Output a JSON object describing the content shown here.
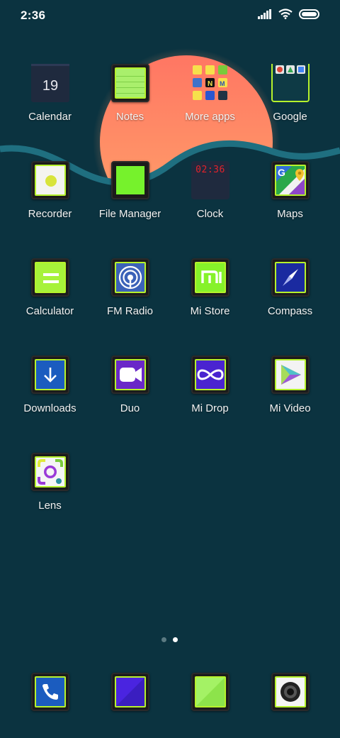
{
  "status": {
    "time": "2:36"
  },
  "colors": {
    "background": "#0b3340",
    "sun_top": "#ff7a63",
    "sun_bottom": "#ffa06a",
    "wave": "#1f6f80",
    "accent": "#b6f22c"
  },
  "apps": [
    {
      "label": "Calendar",
      "icon": "calendar-icon",
      "date": "19"
    },
    {
      "label": "Notes",
      "icon": "notes-icon"
    },
    {
      "label": "More apps",
      "icon": "folder-icon"
    },
    {
      "label": "Google",
      "icon": "google-folder-icon"
    },
    {
      "label": "Recorder",
      "icon": "recorder-icon"
    },
    {
      "label": "File Manager",
      "icon": "file-manager-icon"
    },
    {
      "label": "Clock",
      "icon": "clock-icon",
      "display": "02:36"
    },
    {
      "label": "Maps",
      "icon": "maps-icon"
    },
    {
      "label": "Calculator",
      "icon": "calculator-icon"
    },
    {
      "label": "FM Radio",
      "icon": "radio-icon"
    },
    {
      "label": "Mi Store",
      "icon": "mi-store-icon"
    },
    {
      "label": "Compass",
      "icon": "compass-icon"
    },
    {
      "label": "Downloads",
      "icon": "download-icon"
    },
    {
      "label": "Duo",
      "icon": "video-call-icon"
    },
    {
      "label": "Mi Drop",
      "icon": "mi-drop-icon"
    },
    {
      "label": "Mi Video",
      "icon": "play-icon"
    },
    {
      "label": "Lens",
      "icon": "lens-icon"
    }
  ],
  "pager": {
    "pages": 2,
    "current": 2
  },
  "dock": [
    {
      "icon": "phone-icon"
    },
    {
      "icon": "messages-icon"
    },
    {
      "icon": "browser-icon"
    },
    {
      "icon": "camera-icon"
    }
  ]
}
